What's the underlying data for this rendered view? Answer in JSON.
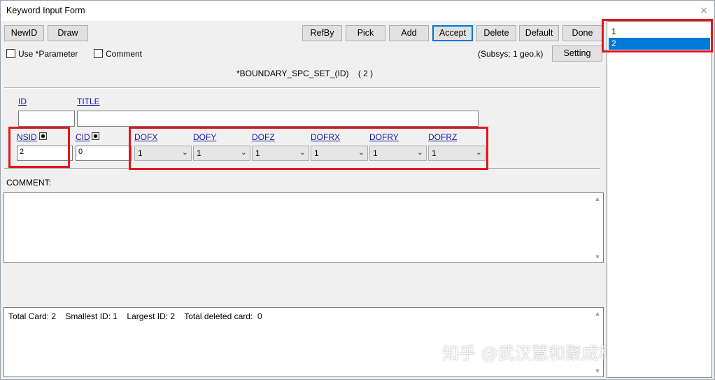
{
  "window": {
    "title": "Keyword Input Form",
    "close_glyph": "×"
  },
  "toolbar": {
    "newid": "NewID",
    "draw": "Draw",
    "refby": "RefBy",
    "pick": "Pick",
    "add": "Add",
    "accept": "Accept",
    "delete": "Delete",
    "default": "Default",
    "done": "Done"
  },
  "options": {
    "use_parameter": "Use *Parameter",
    "comment": "Comment",
    "subsys": "(Subsys: 1 geo.k)",
    "setting": "Setting"
  },
  "keyword": {
    "name": "*BOUNDARY_SPC_SET_(ID)",
    "count": "( 2 )"
  },
  "fields": {
    "id": {
      "label": "ID",
      "value": ""
    },
    "title": {
      "label": "TITLE",
      "value": ""
    },
    "nsid": {
      "label": "NSID",
      "value": "2"
    },
    "cid": {
      "label": "CID",
      "value": "0"
    },
    "dofs": [
      {
        "label": "DOFX",
        "value": "1"
      },
      {
        "label": "DOFY",
        "value": "1"
      },
      {
        "label": "DOFZ",
        "value": "1"
      },
      {
        "label": "DOFRX",
        "value": "1"
      },
      {
        "label": "DOFRY",
        "value": "1"
      },
      {
        "label": "DOFRZ",
        "value": "1"
      }
    ]
  },
  "comment_section": {
    "label": "COMMENT:",
    "text": ""
  },
  "summary": {
    "text": "Total Card: 2    Smallest ID: 1    Largest ID: 2    Total deleted card:  0"
  },
  "id_list": {
    "items": [
      "1",
      "2"
    ],
    "selected": "2"
  },
  "watermark": "知乎 @武汉慧和聚成科技...",
  "colors": {
    "highlight_box": "#e3161c",
    "selection": "#0078d7",
    "link": "#1a1aa6"
  }
}
